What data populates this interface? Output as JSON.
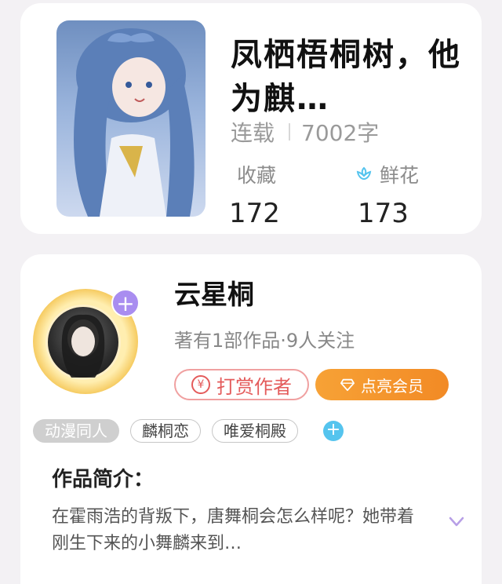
{
  "book": {
    "title": "凤栖梧桐树，他为麒…",
    "status": "连载",
    "word_count": "7002字",
    "favorites_label": "收藏",
    "favorites_count": "172",
    "flowers_label": "鲜花",
    "flowers_count": "173"
  },
  "author": {
    "name": "云星桐",
    "subtitle": "著有1部作品·9人关注",
    "reward_label": "打赏作者",
    "reward_icon": "¥",
    "vip_label": "点亮会员",
    "follow_plus": "+"
  },
  "tags": {
    "items": [
      "动漫同人",
      "麟桐恋",
      "唯爱桐殿"
    ],
    "add_label": "+"
  },
  "intro": {
    "heading": "作品简介：",
    "text": "在霍雨浩的背叛下，唐舞桐会怎么样呢？她带着刚生下来的小舞麟来到…"
  },
  "colors": {
    "reward": "#e45b5b",
    "vip": "#f28a25",
    "flower_icon": "#55c4ee",
    "plus_badge": "#a98df0"
  }
}
